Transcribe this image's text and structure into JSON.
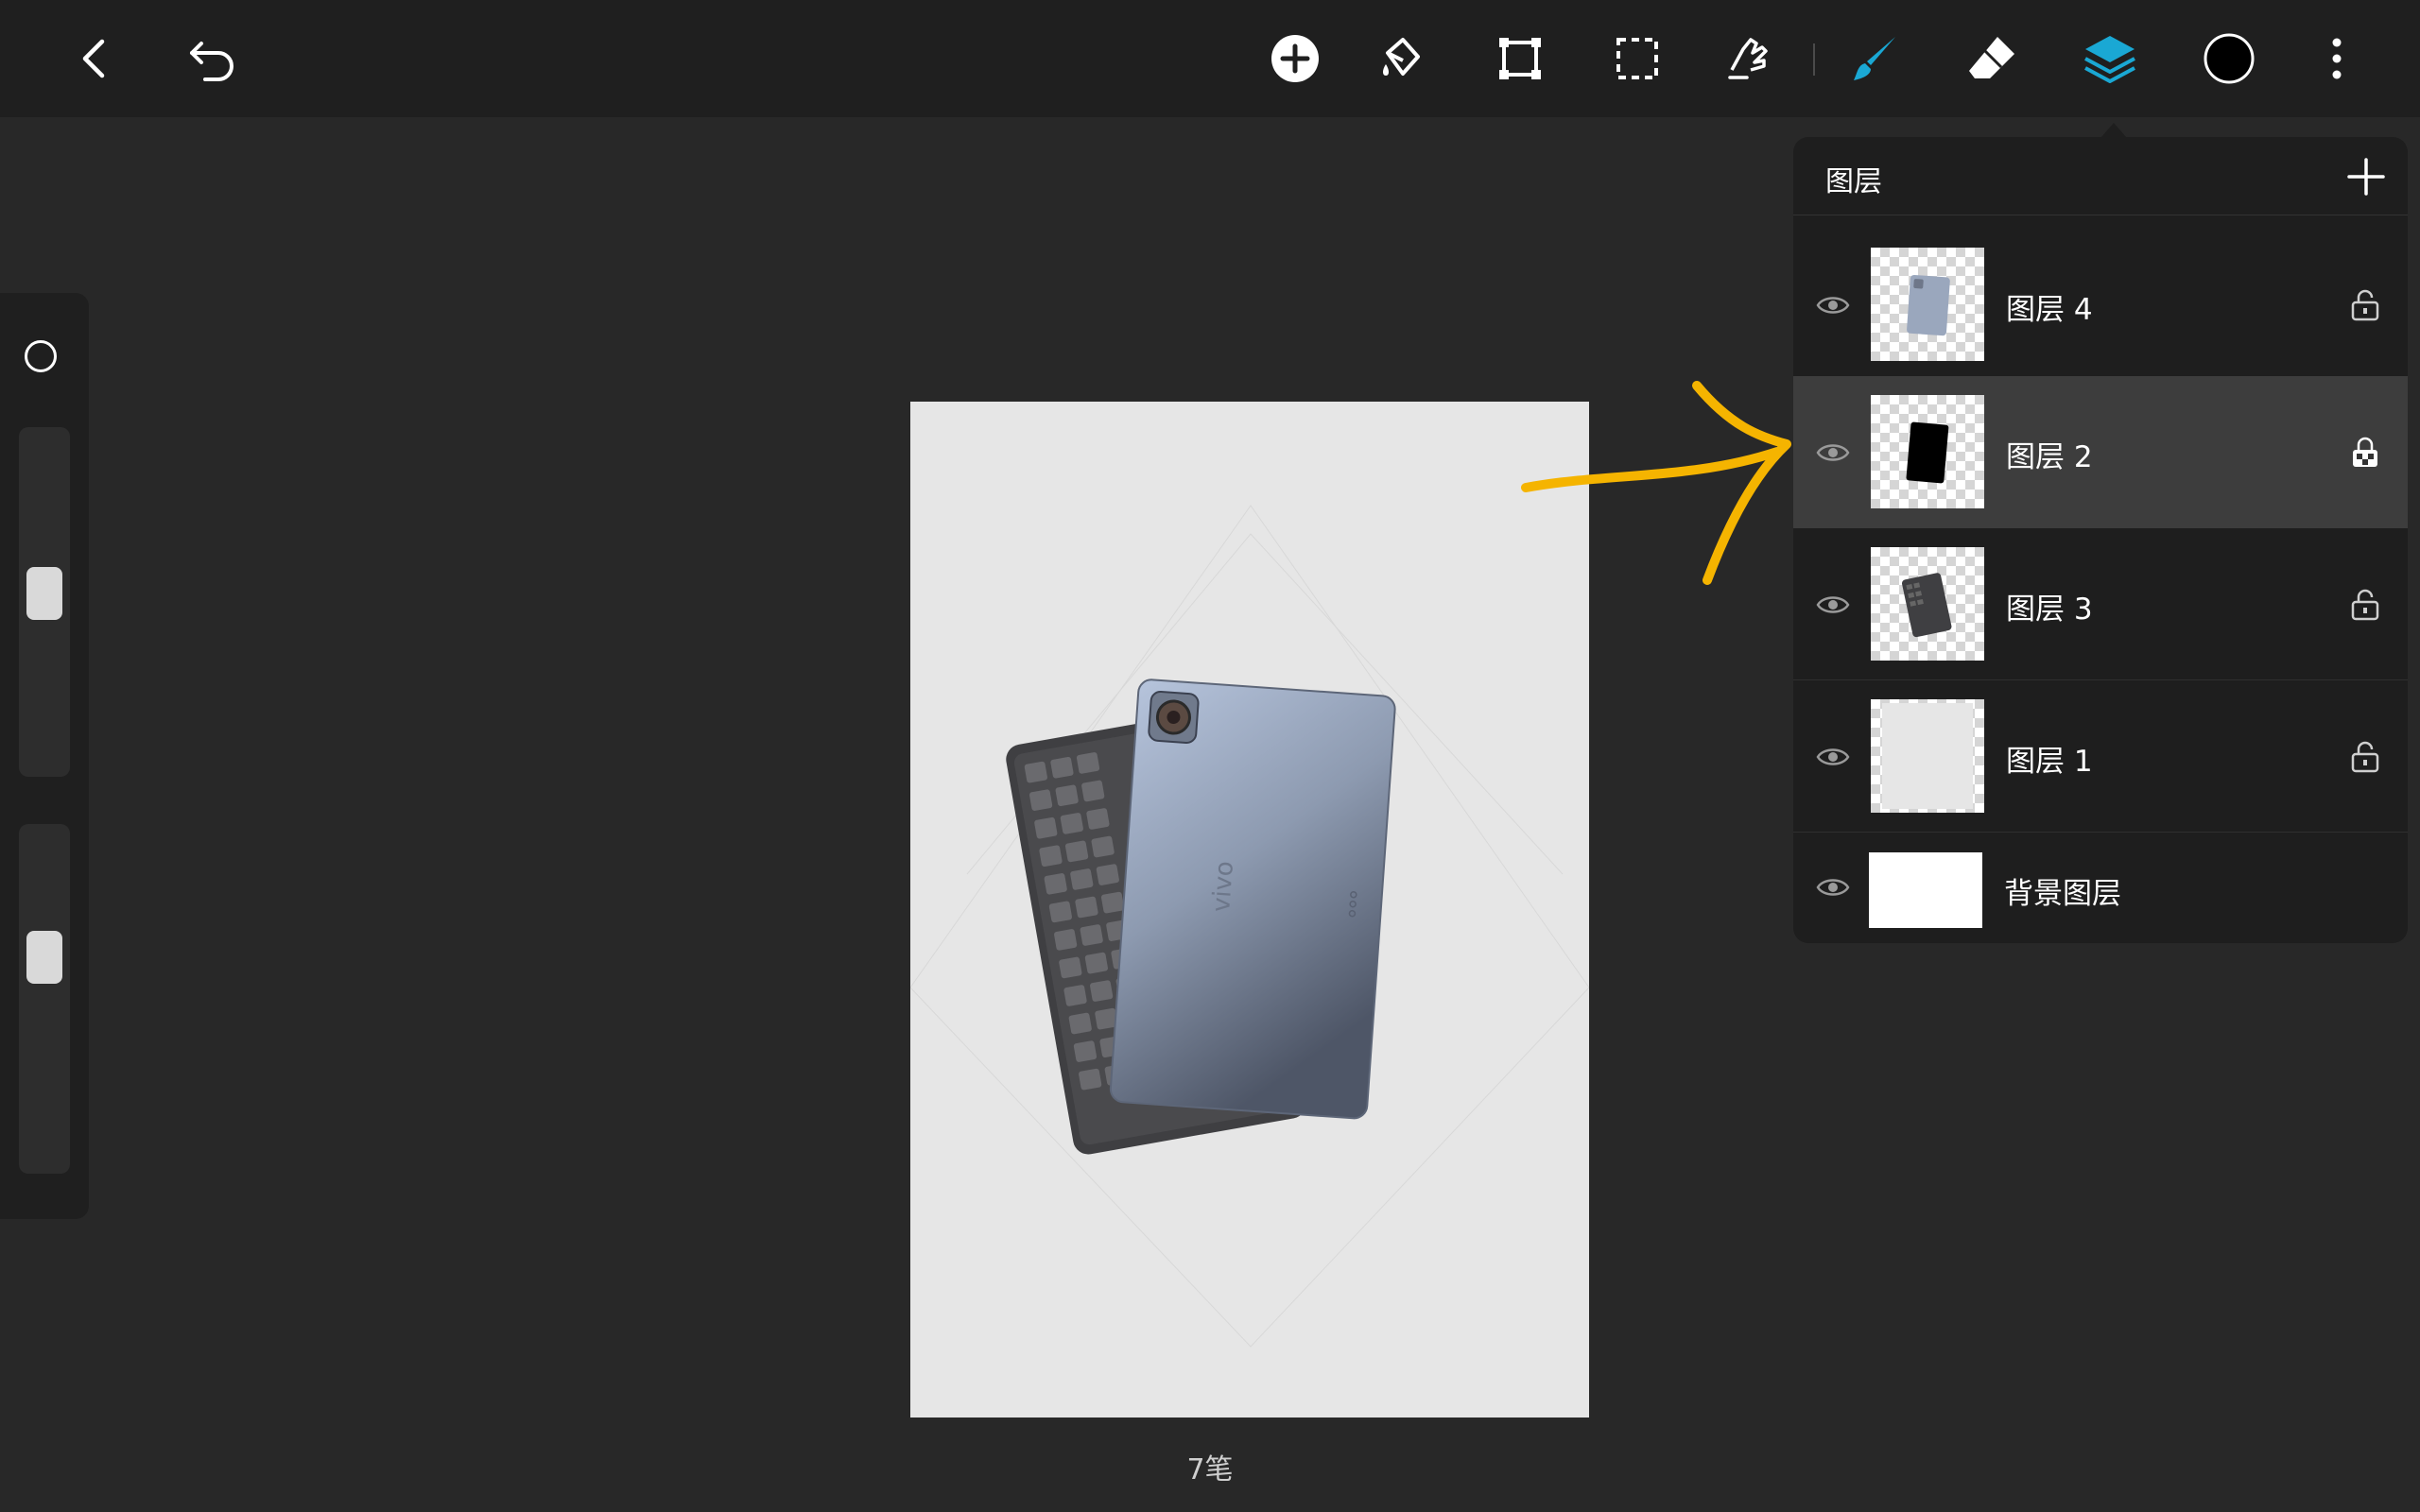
{
  "toolbar": {
    "icons": [
      "back-icon",
      "undo-icon",
      "add-icon",
      "fill-bucket-icon",
      "transform-icon",
      "selection-icon",
      "smudge-icon",
      "brush-icon",
      "eraser-icon",
      "layers-icon",
      "color-picker-icon",
      "more-icon"
    ],
    "accent_color": "#1aa8d4",
    "current_color": "#000000"
  },
  "canvas": {
    "stroke_count": "7笔",
    "background": "#e6e6e6",
    "annotation_arrow_color": "#f5b400"
  },
  "layers_panel": {
    "title": "图层",
    "layers": [
      {
        "name": "图层 4",
        "visible": true,
        "locked": false,
        "selected": false,
        "thumb": "tablet"
      },
      {
        "name": "图层 2",
        "visible": true,
        "locked": false,
        "alpha_lock": true,
        "selected": true,
        "thumb": "black-shape"
      },
      {
        "name": "图层 3",
        "visible": true,
        "locked": false,
        "selected": false,
        "thumb": "keyboard"
      },
      {
        "name": "图层 1",
        "visible": true,
        "locked": false,
        "selected": false,
        "thumb": "gray-fill"
      }
    ],
    "background_layer": {
      "name": "背景图层",
      "visible": true,
      "color": "#ffffff"
    }
  },
  "left_rail": {
    "brush_size_level": 0.47,
    "opacity_level": 0.35
  }
}
